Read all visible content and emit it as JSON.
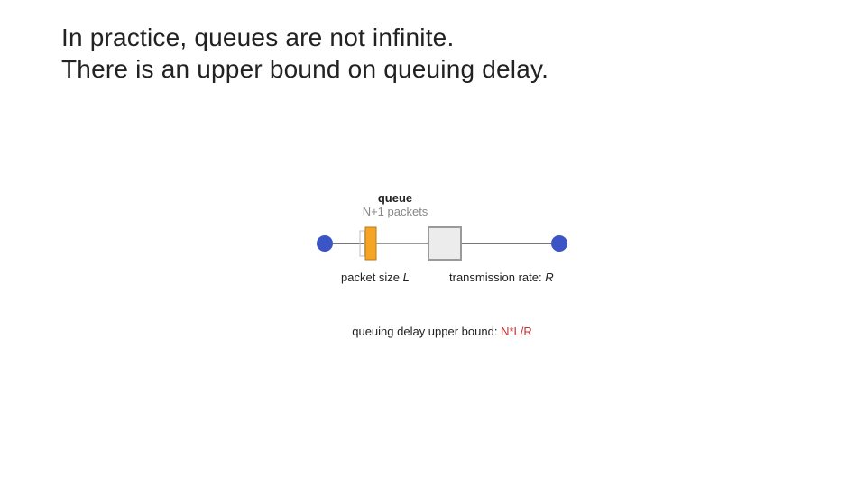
{
  "heading": {
    "line1": "In practice, queues are not infinite.",
    "line2": "There is an upper bound on queuing delay."
  },
  "diagram": {
    "queue_label": "queue",
    "queue_sub": "N+1 packets",
    "packet_size_label": "packet size",
    "packet_size_var": "L",
    "rate_label": "transmission rate:",
    "rate_var": "R",
    "bound_label": "queuing delay upper bound:",
    "bound_value": "N*L/R"
  },
  "chart_data": {
    "type": "diagram",
    "title": "Finite queue & queuing-delay upper bound",
    "nodes": [
      {
        "id": "src",
        "kind": "endpoint"
      },
      {
        "id": "queue",
        "kind": "queue",
        "capacity_packets": "N+1"
      },
      {
        "id": "router",
        "kind": "switch"
      },
      {
        "id": "dst",
        "kind": "endpoint"
      }
    ],
    "edges": [
      {
        "from": "src",
        "to": "queue"
      },
      {
        "from": "queue",
        "to": "router",
        "packet_size": "L"
      },
      {
        "from": "router",
        "to": "dst",
        "transmission_rate": "R"
      }
    ],
    "annotations": [
      {
        "text": "queuing delay upper bound",
        "value": "N*L/R"
      }
    ]
  }
}
